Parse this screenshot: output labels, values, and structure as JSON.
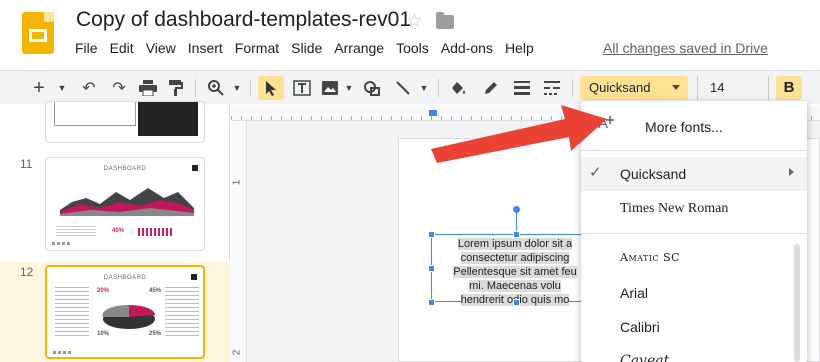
{
  "header": {
    "doc_title": "Copy of dashboard-templates-rev01",
    "menu": [
      "File",
      "Edit",
      "View",
      "Insert",
      "Format",
      "Slide",
      "Arrange",
      "Tools",
      "Add-ons",
      "Help"
    ],
    "saved_status": "All changes saved in Drive"
  },
  "toolbar": {
    "font_name": "Quicksand",
    "font_size": "14",
    "bold_label": "B",
    "icons": [
      "plus-icon",
      "undo-icon",
      "redo-icon",
      "print-icon",
      "paint-format-icon",
      "zoom-icon",
      "select-icon",
      "textbox-icon",
      "image-icon",
      "shape-icon",
      "line-icon",
      "fill-color-icon",
      "border-color-icon",
      "border-weight-icon",
      "border-dash-icon"
    ]
  },
  "slides": {
    "items": [
      {
        "number": "11",
        "title": "DASHBOARD",
        "highlight": "40%"
      },
      {
        "number": "12",
        "title": "DASHBOARD",
        "highlight_a": "20%",
        "highlight_b": "45%",
        "highlight_c": "10%",
        "highlight_d": "25%"
      }
    ]
  },
  "ruler": {
    "left_marks": [
      "1",
      "2"
    ]
  },
  "canvas": {
    "textbox_lines": [
      "Lorem ipsum dolor sit a",
      "consectetur adipiscing",
      "Pellentesque sit amet feu",
      "mi. Maecenas volu",
      "hendrerit odio quis mo"
    ]
  },
  "font_menu": {
    "more_fonts": "More fonts...",
    "fonts": [
      "Quicksand",
      "Times New Roman",
      "Amatic SC",
      "Arial",
      "Calibri",
      "Caveat"
    ],
    "selected": "Quicksand"
  },
  "colors": {
    "accent": "#f4b400",
    "highlight": "#fde293",
    "arrow": "#ea4335",
    "selection": "#4285f4"
  }
}
